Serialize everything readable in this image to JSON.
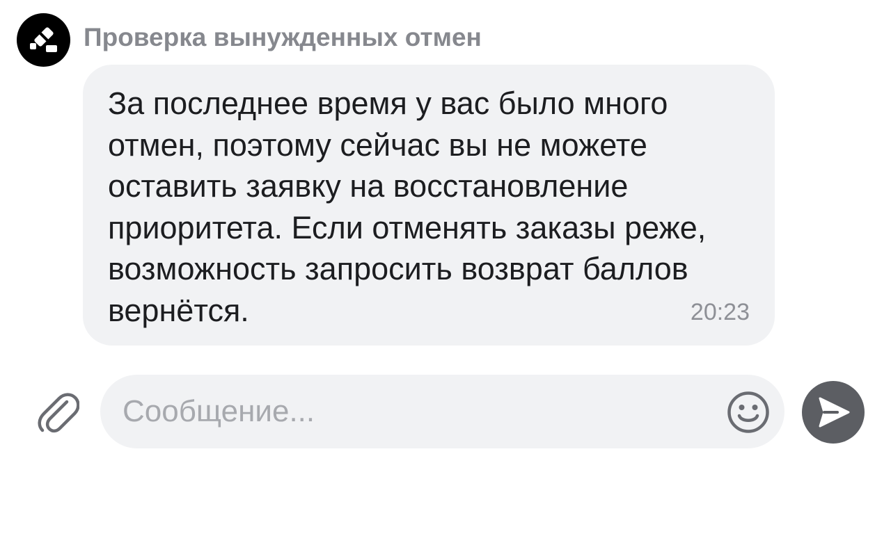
{
  "chat": {
    "sender_name": "Проверка вынужденных отмен",
    "avatar_icon": "gavel-icon"
  },
  "message": {
    "text": "За последнее время у вас было много отмен, поэтому сейчас вы не можете оставить заявку на восстановление приоритета. Если отменять заказы реже, возможность запросить возврат баллов вернётся.",
    "time": "20:23"
  },
  "composer": {
    "placeholder": "Сообщение...",
    "value": "",
    "attach_icon": "paperclip-icon",
    "emoji_icon": "smiley-icon",
    "send_icon": "send-arrow-icon"
  },
  "colors": {
    "avatar_bg": "#000000",
    "bubble_bg": "#f1f2f4",
    "send_button_bg": "#5c5e63",
    "sender_name": "#86888e",
    "text": "#1c1d20"
  }
}
